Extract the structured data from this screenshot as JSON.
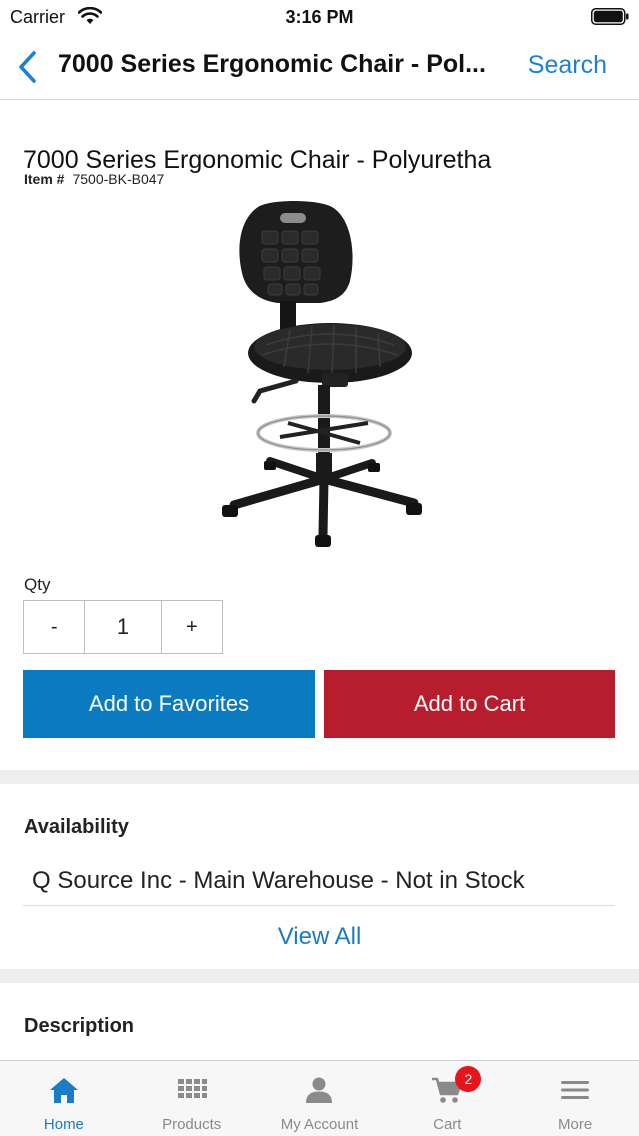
{
  "status_bar": {
    "carrier": "Carrier",
    "time": "3:16 PM"
  },
  "nav": {
    "title": "7000 Series Ergonomic Chair - Pol...",
    "search_label": "Search"
  },
  "product": {
    "name": "7000 Series Ergonomic Chair - Polyuretha",
    "item_label": "Item #",
    "item_number": "7500-BK-B047",
    "image_icon": "ergonomic-chair-photo"
  },
  "quantity": {
    "label": "Qty",
    "decrement": "-",
    "value": "1",
    "increment": "+"
  },
  "actions": {
    "favorites_label": "Add to Favorites",
    "cart_label": "Add to Cart",
    "favorites_color": "#0a7bc0",
    "cart_color": "#b81d2e"
  },
  "availability": {
    "title": "Availability",
    "row": "Q Source Inc - Main Warehouse - Not in Stock",
    "view_all": "View All"
  },
  "description": {
    "title": "Description"
  },
  "tab_bar": {
    "accent": "#1a7cc4",
    "tabs": [
      {
        "label": "Home",
        "icon": "home-icon",
        "active": true
      },
      {
        "label": "Products",
        "icon": "grid-icon",
        "active": false
      },
      {
        "label": "My Account",
        "icon": "person-icon",
        "active": false
      },
      {
        "label": "Cart",
        "icon": "cart-icon",
        "active": false,
        "badge": "2"
      },
      {
        "label": "More",
        "icon": "menu-icon",
        "active": false
      }
    ]
  }
}
